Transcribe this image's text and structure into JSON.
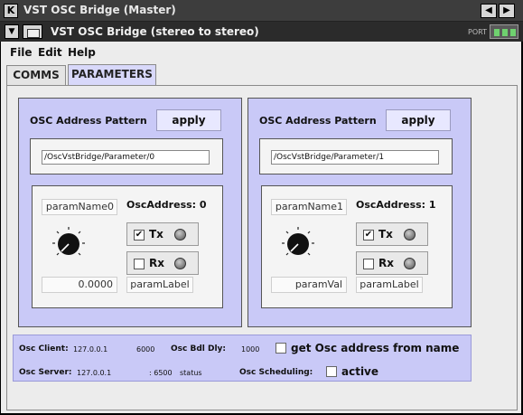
{
  "window": {
    "title": "VST OSC Bridge (Master)",
    "app_icon_glyph": "K",
    "btn_prev": "◀",
    "btn_next": "▶"
  },
  "plugin_bar": {
    "title": "VST OSC Bridge (stereo to stereo)",
    "dropdown_glyph": "▼",
    "port_label": "PORT"
  },
  "menu": {
    "file": "File",
    "edit": "Edit",
    "help": "Help"
  },
  "tabs": {
    "comms": "COMMS",
    "parameters": "PARAMETERS"
  },
  "panels": [
    {
      "pattern_label": "OSC Address Pattern",
      "apply_label": "apply",
      "address_value": "/OscVstBridge/Parameter/0",
      "param_name": "paramName0",
      "osc_address_label": "OscAddress: 0",
      "tx_label": "Tx",
      "tx_checked": "✔",
      "rx_label": "Rx",
      "rx_checked": "",
      "param_value": "0.0000",
      "param_label": "paramLabel"
    },
    {
      "pattern_label": "OSC Address Pattern",
      "apply_label": "apply",
      "address_value": "/OscVstBridge/Parameter/1",
      "param_name": "paramName1",
      "osc_address_label": "OscAddress: 1",
      "tx_label": "Tx",
      "tx_checked": "✔",
      "rx_label": "Rx",
      "rx_checked": "",
      "param_value": "paramVal",
      "param_label": "paramLabel"
    }
  ],
  "status": {
    "osc_client_label": "Osc Client:",
    "osc_client_ip": "127.0.0.1",
    "osc_client_port": "6000",
    "osc_bdl_dly_label": "Osc Bdl Dly:",
    "osc_bdl_dly_value": "1000",
    "get_addr_label": "get Osc address from name",
    "osc_server_label": "Osc Server:",
    "osc_server_ip": "127.0.0.1",
    "osc_server_port": ": 6500",
    "osc_server_status": "status",
    "osc_scheduling_label": "Osc Scheduling:",
    "active_label": "active"
  },
  "colors": {
    "panel_bg": "#c9c9f7",
    "active_tab": "#d8d8fa",
    "client_bg": "#ececec"
  }
}
